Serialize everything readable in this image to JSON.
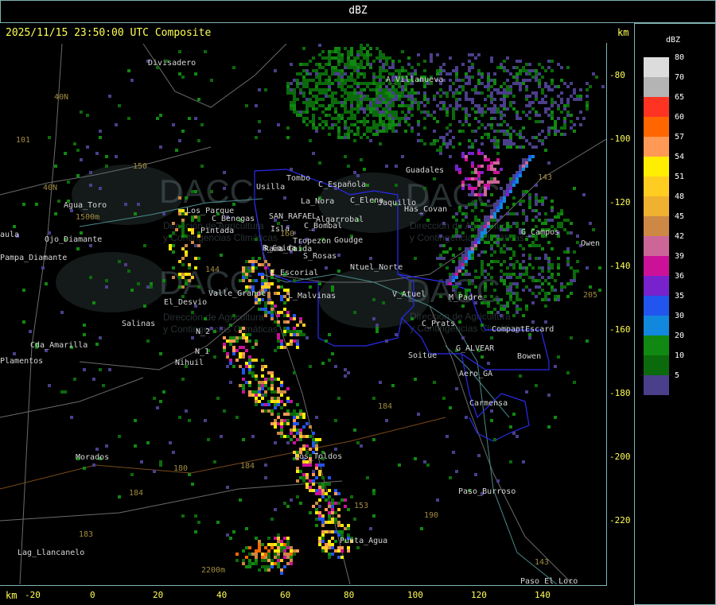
{
  "header": {
    "title": "dBZ"
  },
  "map": {
    "timestamp": "2025/11/15 23:50:00 UTC Composite",
    "unit_right": "km",
    "unit_bottom": "km",
    "x_ticks": [
      "-20",
      "0",
      "20",
      "40",
      "60",
      "80",
      "100",
      "120",
      "140"
    ],
    "y_ticks": [
      "-80",
      "-100",
      "-120",
      "-140",
      "-160",
      "-180",
      "-200",
      "-220"
    ],
    "places": [
      "Divisadero",
      "A_Villanueva",
      "Guadales",
      "Tombo",
      "C_Española",
      "Usilla",
      "La_Nora",
      "C_Elena",
      "Jaquillo",
      "Has_Covan",
      "C_Benegas",
      "SAN_RAFAEL",
      "Algarrobal",
      "Isla",
      "C_Bombal",
      "Tropezon",
      "Goudge",
      "R_Caida",
      "S_Rosas",
      "Ntuel_Norte",
      "G_Campos",
      "Owen",
      "Agua_Toro",
      "Los_Parque",
      "Pintada",
      "Pampa_Diamante",
      "El_Desvio",
      "Valle_Grande",
      "L_Malvinas",
      "Salinas",
      "Cda_Amarilla",
      "N_1",
      "N_2",
      "Nihuil",
      "Soitue",
      "V_Atuel",
      "M_Padre",
      "C_Prats",
      "CompantEscard",
      "G_ALVEAR",
      "Bowen",
      "Aero_GA",
      "Carmensa",
      "Morados",
      "Los_Toldos",
      "Paso_Burroso",
      "Punta_Agua",
      "Lag_Llancanelo",
      "Paso_El_Loro",
      "Ojo_Diamante",
      "Rama_Caida",
      "E_Escorial",
      "Plamentos",
      "aula"
    ],
    "road_labels": [
      "40N",
      "40N",
      "101",
      "150",
      "144",
      "184",
      "180",
      "184",
      "184",
      "183",
      "190",
      "143",
      "205",
      "143",
      "153",
      "160",
      "1500m",
      "2200m"
    ],
    "watermark": {
      "brand": "DACC",
      "line1": "Dirección de Agricultura",
      "line2": "y Contingencias Climáticas"
    }
  },
  "legend": {
    "title": "dBZ",
    "bins": [
      {
        "label": "80",
        "color": "#dcdcdc"
      },
      {
        "label": "70",
        "color": "#b4b4b4"
      },
      {
        "label": "65",
        "color": "#ff3322"
      },
      {
        "label": "60",
        "color": "#ff6600"
      },
      {
        "label": "57",
        "color": "#ff9955"
      },
      {
        "label": "54",
        "color": "#ffee00"
      },
      {
        "label": "51",
        "color": "#ffcc22"
      },
      {
        "label": "48",
        "color": "#f0b030"
      },
      {
        "label": "45",
        "color": "#cc8844"
      },
      {
        "label": "42",
        "color": "#cc6699"
      },
      {
        "label": "39",
        "color": "#cc1199"
      },
      {
        "label": "36",
        "color": "#7722cc"
      },
      {
        "label": "35",
        "color": "#2255ee"
      },
      {
        "label": "30",
        "color": "#1188dd"
      },
      {
        "label": "20",
        "color": "#118811"
      },
      {
        "label": "10",
        "color": "#0b6a0b"
      },
      {
        "label": "5",
        "color": "#4a3f8a"
      }
    ]
  }
}
